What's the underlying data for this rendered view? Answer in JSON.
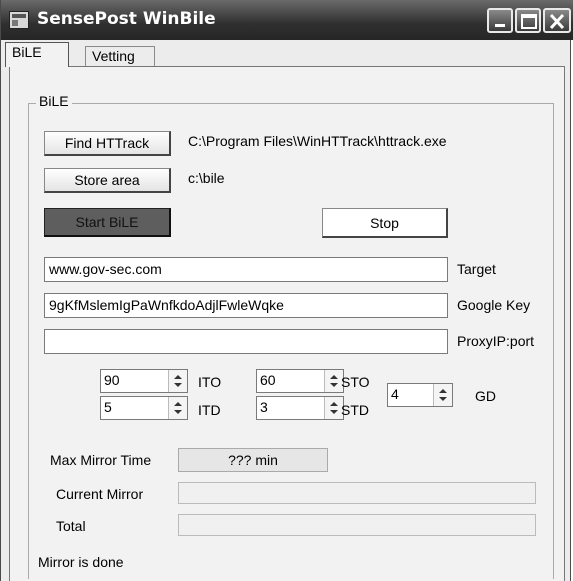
{
  "window": {
    "title": "SensePost WinBile"
  },
  "tabs": [
    {
      "label": "BiLE"
    },
    {
      "label": "Vetting"
    }
  ],
  "group": {
    "label": "BiLE"
  },
  "httrack": {
    "button_label": "Find HTTrack",
    "path": "C:\\Program Files\\WinHTTrack\\httrack.exe"
  },
  "store": {
    "button_label": "Store area",
    "path": "c:\\bile"
  },
  "actions": {
    "start_label": "Start BiLE",
    "stop_label": "Stop"
  },
  "fields": {
    "target": {
      "value": "www.gov-sec.com",
      "label": "Target"
    },
    "google_key": {
      "value": "9gKfMslemIgPaWnfkdoAdjlFwleWqke",
      "label": "Google Key"
    },
    "proxy": {
      "value": "",
      "label": "ProxyIP:port"
    }
  },
  "spinners": {
    "ito": {
      "value": "90",
      "label": "ITO"
    },
    "sto": {
      "value": "60",
      "label": "STO"
    },
    "itd": {
      "value": "5",
      "label": "ITD"
    },
    "std": {
      "value": "3",
      "label": "STD"
    },
    "gd": {
      "value": "4",
      "label": "GD"
    }
  },
  "status": {
    "max_mirror_label": "Max Mirror Time",
    "max_mirror_value": "??? min",
    "current_mirror_label": "Current Mirror",
    "current_mirror_progress": 0,
    "total_label": "Total",
    "total_progress": 0,
    "message": "Mirror is done"
  },
  "colors": {
    "title_bar": "#2f2f2f",
    "progress_fill": "#3a6ea5"
  },
  "icons": {
    "app": "app-window-icon",
    "minimize": "minimize-icon",
    "maximize": "maximize-icon",
    "close": "close-icon"
  }
}
